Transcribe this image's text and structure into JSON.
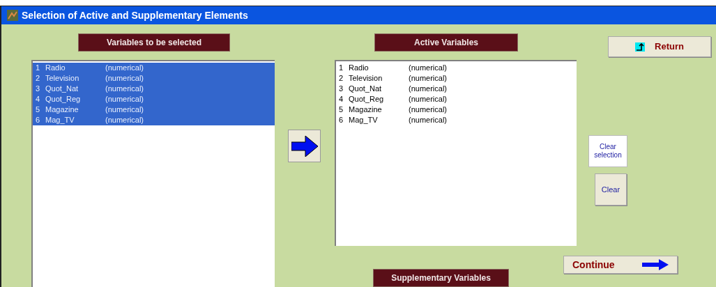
{
  "window": {
    "title": "Selection of Active and Supplementary Elements"
  },
  "variables_to_select": {
    "heading": "Variables to be selected",
    "items": [
      {
        "number": "1",
        "name": "Radio",
        "type": "(numerical)",
        "selected": true
      },
      {
        "number": "2",
        "name": "Television",
        "type": "(numerical)",
        "selected": true
      },
      {
        "number": "3",
        "name": "Quot_Nat",
        "type": "(numerical)",
        "selected": true
      },
      {
        "number": "4",
        "name": "Quot_Reg",
        "type": "(numerical)",
        "selected": true
      },
      {
        "number": "5",
        "name": "Magazine",
        "type": "(numerical)",
        "selected": true
      },
      {
        "number": "6",
        "name": "Mag_TV",
        "type": "(numerical)",
        "selected": true
      }
    ]
  },
  "active_variables": {
    "heading": "Active Variables",
    "items": [
      {
        "number": "1",
        "name": "Radio",
        "type": "(numerical)",
        "selected": false
      },
      {
        "number": "2",
        "name": "Television",
        "type": "(numerical)",
        "selected": false
      },
      {
        "number": "3",
        "name": "Quot_Nat",
        "type": "(numerical)",
        "selected": false
      },
      {
        "number": "4",
        "name": "Quot_Reg",
        "type": "(numerical)",
        "selected": false
      },
      {
        "number": "5",
        "name": "Magazine",
        "type": "(numerical)",
        "selected": false
      },
      {
        "number": "6",
        "name": "Mag_TV",
        "type": "(numerical)",
        "selected": false
      }
    ]
  },
  "supplementary_variables": {
    "heading": "Supplementary Variables"
  },
  "buttons": {
    "return": "Return",
    "clear_selection": "Clear selection",
    "clear": "Clear",
    "continue": "Continue"
  }
}
